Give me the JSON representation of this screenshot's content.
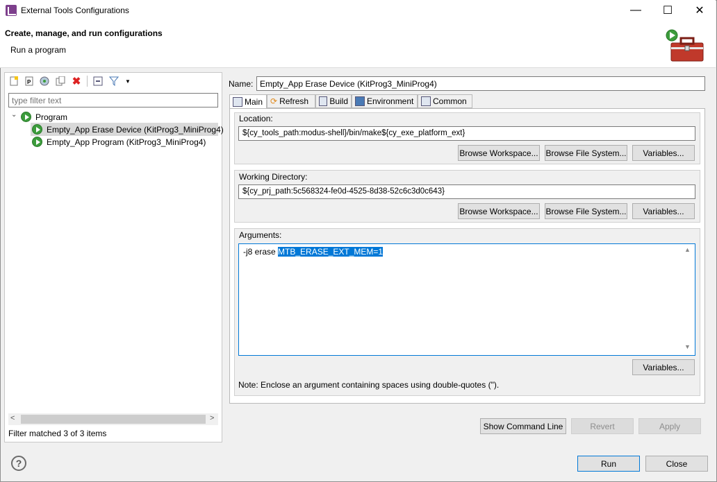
{
  "window": {
    "title": "External Tools Configurations",
    "minimize": "—",
    "maximize": "☐",
    "close": "✕"
  },
  "header": {
    "title": "Create, manage, and run configurations",
    "subtitle": "Run a program"
  },
  "left": {
    "filter_placeholder": "type filter text",
    "tree": {
      "root": "Program",
      "items": [
        "Empty_App Erase Device (KitProg3_MiniProg4)",
        "Empty_App Program (KitProg3_MiniProg4)"
      ]
    },
    "status": "Filter matched 3 of 3 items",
    "scroll_left": "<",
    "scroll_right": ">"
  },
  "config": {
    "name_label": "Name:",
    "name_value": "Empty_App Erase Device (KitProg3_MiniProg4)",
    "tabs": [
      "Main",
      "Refresh",
      "Build",
      "Environment",
      "Common"
    ],
    "location": {
      "label": "Location:",
      "value": "${cy_tools_path:modus-shell}/bin/make${cy_exe_platform_ext}"
    },
    "working_dir": {
      "label": "Working Directory:",
      "value": "${cy_prj_path:5c568324-fe0d-4525-8d38-52c6c3d0c643}"
    },
    "arguments": {
      "label": "Arguments:",
      "value_plain": "-j8 erase ",
      "value_selected": "MTB_ERASE_EXT_MEM=1"
    },
    "browse_workspace": "Browse Workspace...",
    "browse_filesystem": "Browse File System...",
    "variables": "Variables...",
    "note": "Note: Enclose an argument containing spaces using double-quotes (\")."
  },
  "buttons": {
    "show_command_line": "Show Command Line",
    "revert": "Revert",
    "apply": "Apply",
    "run": "Run",
    "close": "Close",
    "help": "?"
  },
  "colors": {
    "accent": "#0078d7",
    "run_green": "#3c9c3c"
  }
}
